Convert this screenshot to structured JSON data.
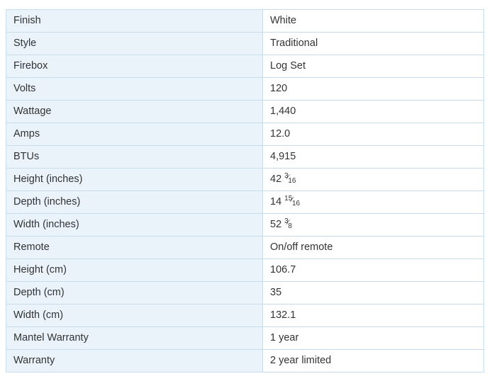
{
  "specs": [
    {
      "label": "Finish",
      "value": "White"
    },
    {
      "label": "Style",
      "value": "Traditional"
    },
    {
      "label": "Firebox",
      "value": "Log Set"
    },
    {
      "label": "Volts",
      "value": "120"
    },
    {
      "label": "Wattage",
      "value": "1,440"
    },
    {
      "label": "Amps",
      "value": "12.0"
    },
    {
      "label": "BTUs",
      "value": "4,915"
    },
    {
      "label": "Height (inches)",
      "value": "42",
      "frac": {
        "num": "3",
        "den": "16"
      }
    },
    {
      "label": "Depth (inches)",
      "value": "14",
      "frac": {
        "num": "15",
        "den": "16"
      }
    },
    {
      "label": "Width (inches)",
      "value": "52",
      "frac": {
        "num": "3",
        "den": "8"
      }
    },
    {
      "label": "Remote",
      "value": "On/off remote"
    },
    {
      "label": "Height (cm)",
      "value": "106.7"
    },
    {
      "label": "Depth (cm)",
      "value": "35"
    },
    {
      "label": "Width (cm)",
      "value": "132.1"
    },
    {
      "label": "Mantel Warranty",
      "value": "1 year"
    },
    {
      "label": "Warranty",
      "value": "2 year limited"
    }
  ]
}
